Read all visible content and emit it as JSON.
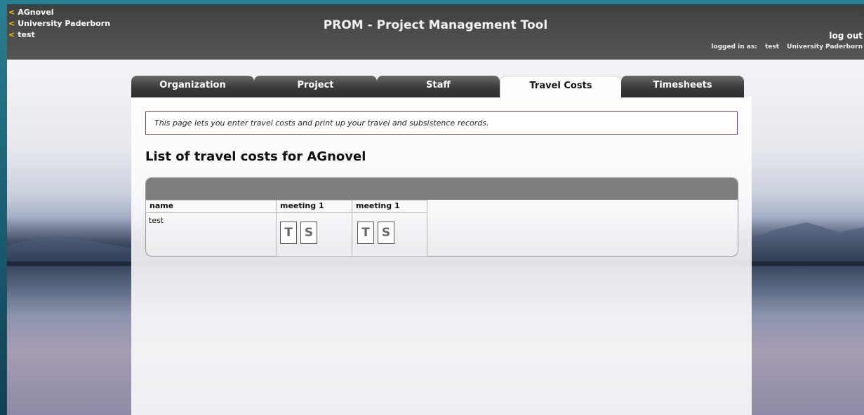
{
  "breadcrumbs": [
    "AGnovel",
    "University Paderborn",
    "test"
  ],
  "header": {
    "title": "PROM - Project Management Tool",
    "logout": "log out",
    "logged_in_label": "logged in as:",
    "logged_in_user": "test",
    "logged_in_org": "University Paderborn"
  },
  "tabs": [
    {
      "label": "Organization",
      "active": false
    },
    {
      "label": "Project",
      "active": false
    },
    {
      "label": "Staff",
      "active": false
    },
    {
      "label": "Travel Costs",
      "active": true
    },
    {
      "label": "Timesheets",
      "active": false
    }
  ],
  "info_text": "This page lets you enter travel costs and print up your travel and subsistence records.",
  "page_heading": "List of travel costs for AGnovel",
  "table": {
    "columns": [
      "name",
      "meeting 1",
      "meeting 1"
    ],
    "rows": [
      {
        "name": "test",
        "meetings": [
          {
            "t_label": "T",
            "s_label": "S"
          },
          {
            "t_label": "T",
            "s_label": "S"
          }
        ]
      }
    ]
  },
  "colors": {
    "header_bg": "#4a4a4a",
    "crumb_arrow": "#ffcc00",
    "info_border": "#6a3d9a",
    "frame": "#2a7f92"
  }
}
